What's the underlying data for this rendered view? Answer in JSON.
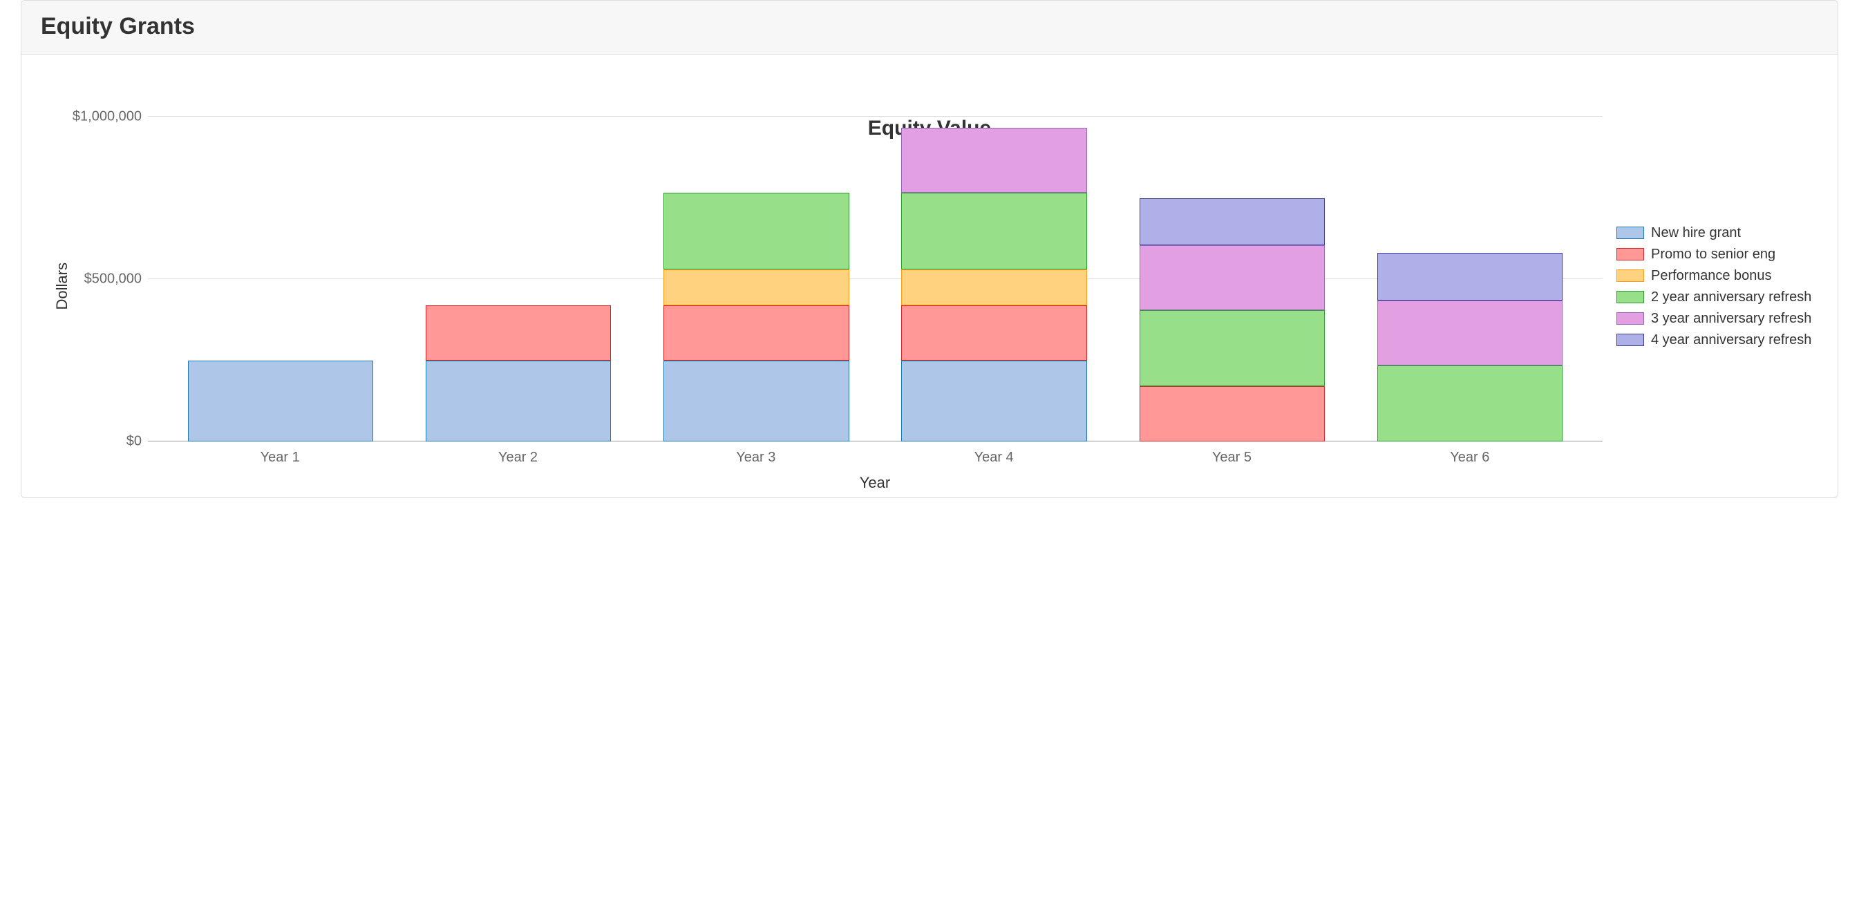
{
  "panel": {
    "title": "Equity Grants"
  },
  "chart_data": {
    "type": "bar",
    "stacked": true,
    "title": "Equity Value",
    "xlabel": "Year",
    "ylabel": "Dollars",
    "ylim": [
      0,
      1000000
    ],
    "y_ticks": [
      {
        "value": 0,
        "label": "$0"
      },
      {
        "value": 500000,
        "label": "$500,000"
      },
      {
        "value": 1000000,
        "label": "$1,000,000"
      }
    ],
    "categories": [
      "Year 1",
      "Year 2",
      "Year 3",
      "Year 4",
      "Year 5",
      "Year 6"
    ],
    "series": [
      {
        "name": "New hire grant",
        "fill": "#aec7e8",
        "stroke": "#1f77b4",
        "values": [
          250000,
          250000,
          250000,
          250000,
          0,
          0
        ]
      },
      {
        "name": "Promo to senior eng",
        "fill": "#ff9896",
        "stroke": "#d62728",
        "values": [
          0,
          170000,
          170000,
          170000,
          170000,
          0
        ]
      },
      {
        "name": "Performance bonus",
        "fill": "#ffd27f",
        "stroke": "#ff9e1b",
        "values": [
          0,
          0,
          110000,
          110000,
          0,
          0
        ]
      },
      {
        "name": "2 year anniversary refresh",
        "fill": "#98df8a",
        "stroke": "#2ca02c",
        "values": [
          0,
          0,
          235000,
          235000,
          235000,
          235000
        ]
      },
      {
        "name": "3 year anniversary refresh",
        "fill": "#e29fe2",
        "stroke": "#9467bd",
        "values": [
          0,
          0,
          0,
          200000,
          200000,
          200000
        ]
      },
      {
        "name": "4 year anniversary refresh",
        "fill": "#b0b0e8",
        "stroke": "#3b3b98",
        "values": [
          0,
          0,
          0,
          0,
          145000,
          145000
        ]
      }
    ]
  }
}
